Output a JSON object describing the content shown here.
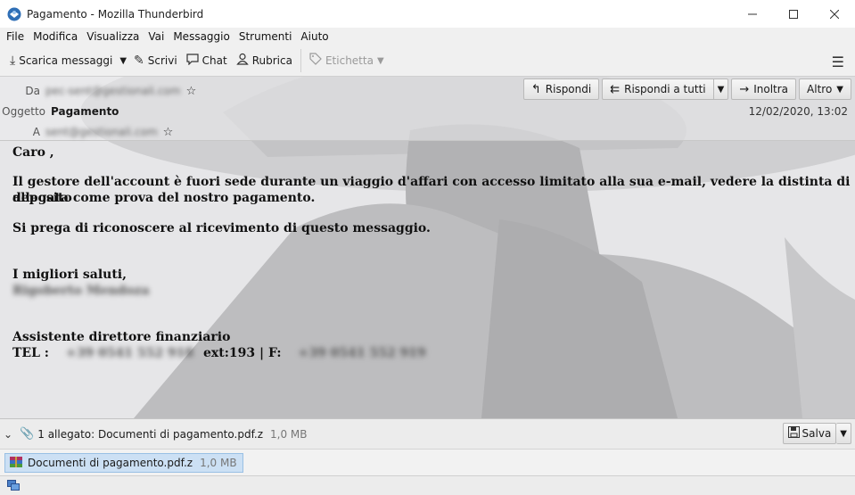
{
  "window": {
    "title": "Pagamento - Mozilla Thunderbird",
    "controls": [
      "minimize",
      "maximize",
      "close"
    ]
  },
  "menu": [
    {
      "label": "File",
      "name": "menu-file"
    },
    {
      "label": "Modifica",
      "name": "menu-modifica"
    },
    {
      "label": "Visualizza",
      "name": "menu-visualizza"
    },
    {
      "label": "Vai",
      "name": "menu-vai"
    },
    {
      "label": "Messaggio",
      "name": "menu-messaggio"
    },
    {
      "label": "Strumenti",
      "name": "menu-strumenti"
    },
    {
      "label": "Aiuto",
      "name": "menu-aiuto"
    }
  ],
  "toolbar": {
    "scarica": "Scarica messaggi",
    "scrivi": "Scrivi",
    "chat": "Chat",
    "rubrica": "Rubrica",
    "etichetta": "Etichetta"
  },
  "header": {
    "from_label": "Da",
    "from_value": "pec-sent@gestionali.com",
    "subject_label": "Oggetto",
    "subject_value": "Pagamento",
    "to_label": "A",
    "to_value": "sent@gestionali.com",
    "date": "12/02/2020, 13:02",
    "actions": {
      "reply": "Rispondi",
      "reply_all": "Rispondi a tutti",
      "forward": "Inoltra",
      "more": "Altro"
    }
  },
  "body": {
    "greeting": "Caro ,",
    "paragraph1_line1": "Il gestore dell'account è fuori sede durante un viaggio d'affari con accesso limitato alla sua e-mail, vedere la distinta di deposito",
    "paragraph1_line2": "allegata come prova del nostro pagamento.",
    "paragraph2": "Si prega di riconoscere al ricevimento di questo messaggio.",
    "closing": "I migliori saluti,",
    "signer_name": "Rigoberto Mendoza",
    "role": "Assistente direttore finanziario",
    "tel_label": "TEL :",
    "tel_value": "+39 0541 552 918",
    "ext": "ext:193 | F:",
    "fax_value": "+39 0541 552 919"
  },
  "attachments": {
    "summary": "1 allegato: Documenti di pagamento.pdf.z",
    "summary_size": "1,0 MB",
    "save_label": "Salva",
    "items": [
      {
        "name": "Documenti di pagamento.pdf.z",
        "size": "1,0 MB"
      }
    ]
  },
  "colors": {
    "selected_attachment": "#cce0f4",
    "toolbar_bg": "#f0f0f0"
  }
}
